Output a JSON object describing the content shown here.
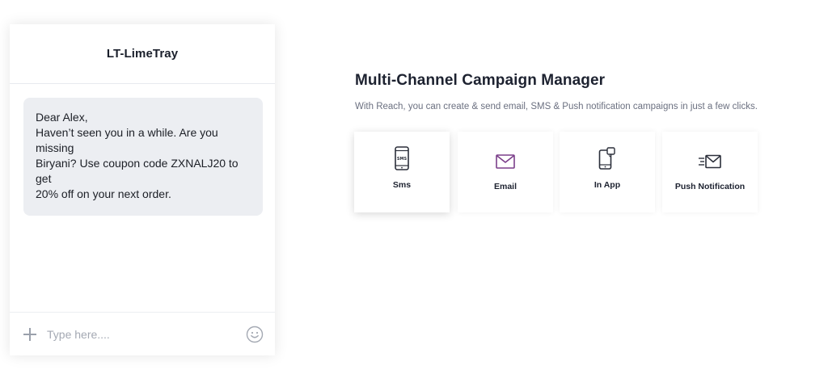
{
  "chat": {
    "title": "LT-LimeTray",
    "message": {
      "line1": "Dear Alex,",
      "line2": "Haven’t seen you in a while. Are you missing",
      "line3": "Biryani? Use coupon code ZXNALJ20 to get",
      "line4": "20% off on your next order."
    },
    "composer": {
      "placeholder": "Type here...."
    }
  },
  "campaign": {
    "title": "Multi-Channel Campaign Manager",
    "subtitle": "With Reach, you can create & send email, SMS & Push notification campaigns in just a few clicks.",
    "channels": [
      {
        "label": "Sms",
        "icon": "sms-phone-icon",
        "icon_text": "SMS",
        "active": true
      },
      {
        "label": "Email",
        "icon": "envelope-icon",
        "active": false
      },
      {
        "label": "In App",
        "icon": "phone-notification-icon",
        "active": false
      },
      {
        "label": "Push Notification",
        "icon": "send-mail-icon",
        "active": false
      }
    ]
  },
  "colors": {
    "accent": "#7b3f8a",
    "icon_dark": "#2b2f3a",
    "bubble_bg": "#eceef2"
  }
}
